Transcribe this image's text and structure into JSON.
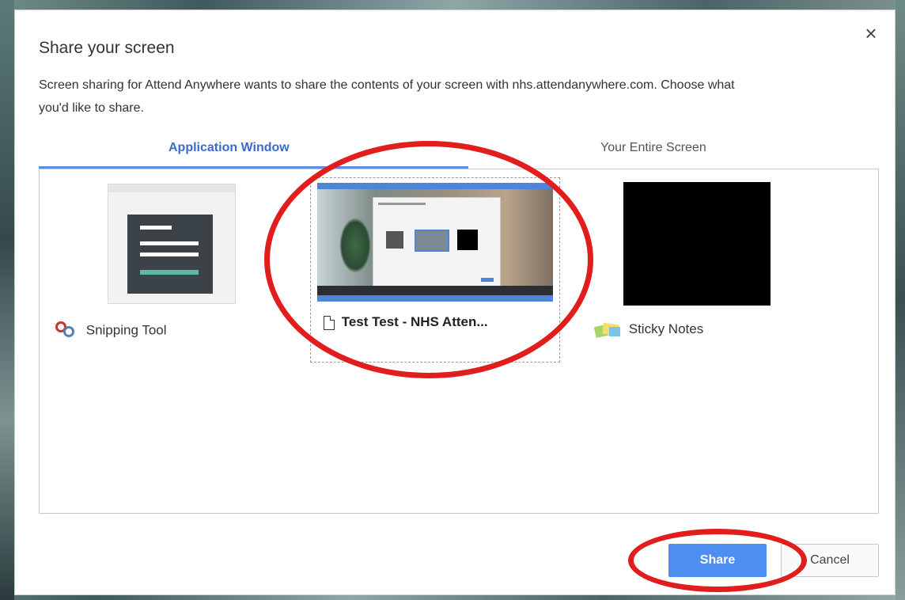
{
  "dialog": {
    "title": "Share your screen",
    "description": "Screen sharing for Attend Anywhere wants to share the contents of your screen with nhs.attendanywhere.com. Choose what you'd like to share.",
    "close_glyph": "×"
  },
  "tabs": [
    {
      "label": "Application Window",
      "selected": true
    },
    {
      "label": "Your Entire Screen",
      "selected": false
    }
  ],
  "windows": [
    {
      "label": "Snipping Tool",
      "icon": "snipping-tool-icon",
      "selected": false
    },
    {
      "label": "Test Test - NHS Atten...",
      "icon": "document-icon",
      "selected": true
    },
    {
      "label": "Sticky Notes",
      "icon": "sticky-notes-icon",
      "selected": false
    }
  ],
  "buttons": {
    "share": "Share",
    "cancel": "Cancel"
  },
  "colors": {
    "accent": "#4d8ef0",
    "tab_selected": "#3b6bc9",
    "annotation": "#e21d1d"
  }
}
